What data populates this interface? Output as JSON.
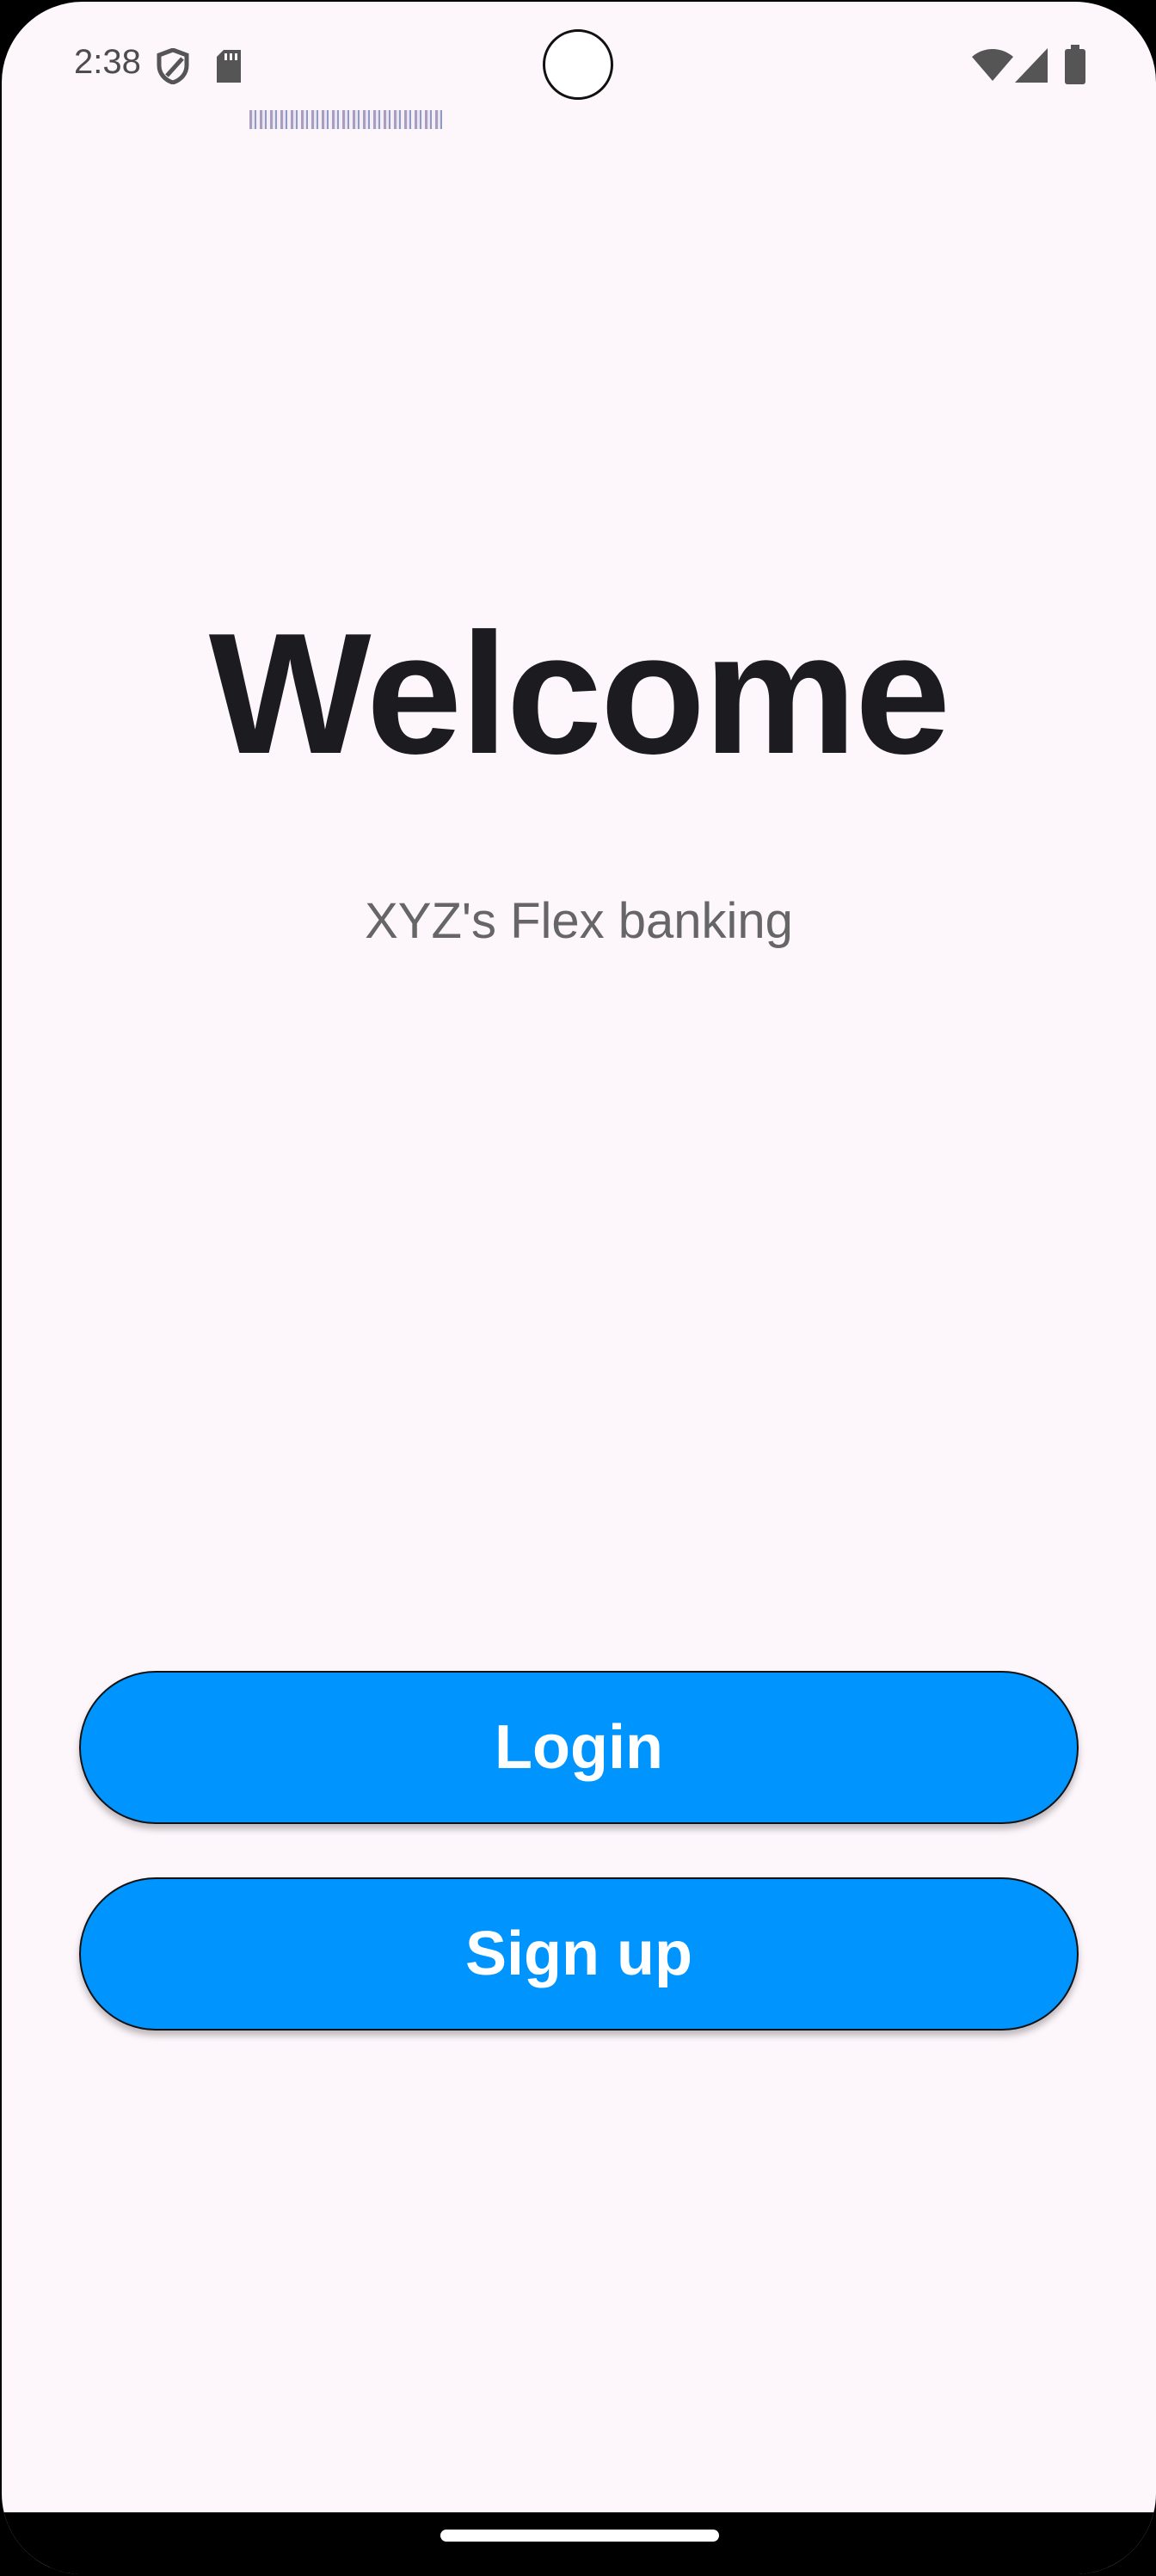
{
  "status_bar": {
    "time": "2:38",
    "icons": [
      "shield-icon",
      "sd-card-icon",
      "wifi-icon",
      "signal-icon",
      "battery-icon"
    ]
  },
  "main": {
    "title": "Welcome",
    "subtitle": "XYZ's Flex banking"
  },
  "buttons": {
    "login_label": "Login",
    "signup_label": "Sign up"
  },
  "colors": {
    "background": "#fdf6fb",
    "accent": "#0094ff",
    "title_text": "#1c1b1f",
    "subtitle_text": "#666666"
  }
}
